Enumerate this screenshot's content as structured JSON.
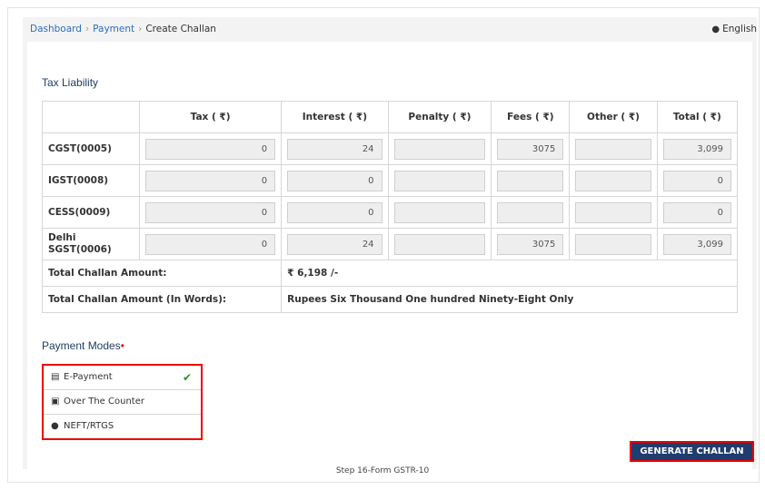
{
  "breadcrumb": {
    "items": [
      "Dashboard",
      "Payment"
    ],
    "current": "Create Challan"
  },
  "language": {
    "label": "English",
    "icon": "globe-icon"
  },
  "tax_liability": {
    "title": "Tax Liability",
    "columns": [
      "",
      "Tax ( ₹)",
      "Interest ( ₹)",
      "Penalty ( ₹)",
      "Fees ( ₹)",
      "Other ( ₹)",
      "Total ( ₹)"
    ],
    "rows": [
      {
        "label": "CGST(0005)",
        "values": [
          "0",
          "24",
          "",
          "3075",
          "",
          "3,099"
        ]
      },
      {
        "label": "IGST(0008)",
        "values": [
          "0",
          "0",
          "",
          "",
          "",
          "0"
        ]
      },
      {
        "label": "CESS(0009)",
        "values": [
          "0",
          "0",
          "",
          "",
          "",
          "0"
        ]
      },
      {
        "label": "Delhi SGST(0006)",
        "values": [
          "0",
          "24",
          "",
          "3075",
          "",
          "3,099"
        ]
      }
    ],
    "total_label": "Total Challan Amount:",
    "total_value": "₹ 6,198 /-",
    "words_label": "Total Challan Amount (In Words):",
    "words_value": "Rupees Six Thousand One hundred Ninety-Eight Only"
  },
  "payment_modes": {
    "title": "Payment Modes",
    "required_mark": "•",
    "options": [
      {
        "label": "E-Payment",
        "icon": "credit-card-icon",
        "selected": true
      },
      {
        "label": "Over The Counter",
        "icon": "cash-icon",
        "selected": false
      },
      {
        "label": "NEFT/RTGS",
        "icon": "globe-icon",
        "selected": false
      }
    ]
  },
  "actions": {
    "generate_label": "GENERATE CHALLAN"
  },
  "caption": "Step 16-Form GSTR-10",
  "colors": {
    "accent": "#1f3d6f",
    "highlight": "#e00000",
    "link": "#2a6ebd",
    "check": "#2e8b2e"
  }
}
